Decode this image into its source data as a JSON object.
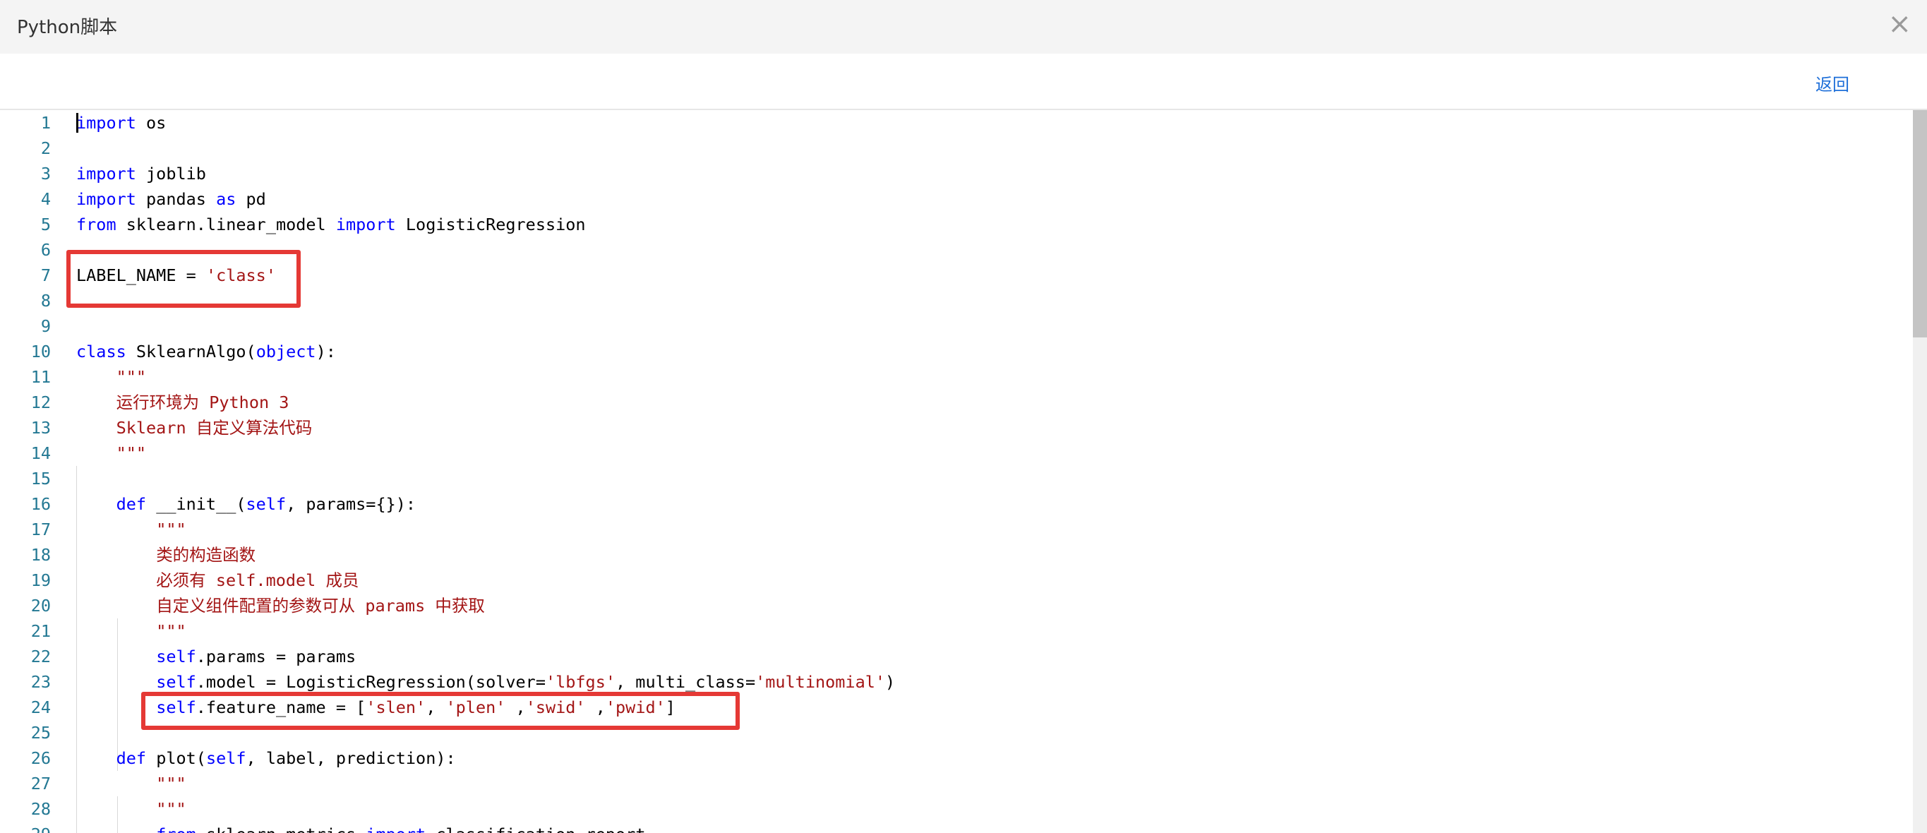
{
  "dialog": {
    "title": "Python脚本",
    "close_icon": "×",
    "back_label": "返回"
  },
  "editor": {
    "language": "python",
    "lines": [
      {
        "num": "1",
        "tokens": [
          {
            "t": "import",
            "c": "kw"
          },
          {
            "t": " os",
            "c": "text"
          }
        ]
      },
      {
        "num": "2",
        "tokens": []
      },
      {
        "num": "3",
        "tokens": [
          {
            "t": "import",
            "c": "kw"
          },
          {
            "t": " joblib",
            "c": "text"
          }
        ]
      },
      {
        "num": "4",
        "tokens": [
          {
            "t": "import",
            "c": "kw"
          },
          {
            "t": " pandas ",
            "c": "text"
          },
          {
            "t": "as",
            "c": "kw"
          },
          {
            "t": " pd",
            "c": "text"
          }
        ]
      },
      {
        "num": "5",
        "tokens": [
          {
            "t": "from",
            "c": "kw"
          },
          {
            "t": " sklearn.linear_model ",
            "c": "text"
          },
          {
            "t": "import",
            "c": "kw"
          },
          {
            "t": " LogisticRegression",
            "c": "text"
          }
        ]
      },
      {
        "num": "6",
        "tokens": []
      },
      {
        "num": "7",
        "tokens": [
          {
            "t": "LABEL_NAME = ",
            "c": "text"
          },
          {
            "t": "'class'",
            "c": "str"
          }
        ]
      },
      {
        "num": "8",
        "tokens": []
      },
      {
        "num": "9",
        "tokens": []
      },
      {
        "num": "10",
        "tokens": [
          {
            "t": "class",
            "c": "kw"
          },
          {
            "t": " SklearnAlgo(",
            "c": "text"
          },
          {
            "t": "object",
            "c": "kw"
          },
          {
            "t": "):",
            "c": "text"
          }
        ]
      },
      {
        "num": "11",
        "tokens": [
          {
            "t": "    ",
            "c": "text"
          },
          {
            "t": "\"\"\"",
            "c": "str"
          }
        ]
      },
      {
        "num": "12",
        "tokens": [
          {
            "t": "    ",
            "c": "text"
          },
          {
            "t": "运行环境为 Python 3",
            "c": "str"
          }
        ]
      },
      {
        "num": "13",
        "tokens": [
          {
            "t": "    ",
            "c": "text"
          },
          {
            "t": "Sklearn 自定义算法代码",
            "c": "str"
          }
        ]
      },
      {
        "num": "14",
        "tokens": [
          {
            "t": "    ",
            "c": "text"
          },
          {
            "t": "\"\"\"",
            "c": "str"
          }
        ]
      },
      {
        "num": "15",
        "tokens": []
      },
      {
        "num": "16",
        "tokens": [
          {
            "t": "    ",
            "c": "text"
          },
          {
            "t": "def",
            "c": "kw"
          },
          {
            "t": " __init__(",
            "c": "text"
          },
          {
            "t": "self",
            "c": "kw"
          },
          {
            "t": ", params={}):",
            "c": "text"
          }
        ]
      },
      {
        "num": "17",
        "tokens": [
          {
            "t": "        ",
            "c": "text"
          },
          {
            "t": "\"\"\"",
            "c": "str"
          }
        ]
      },
      {
        "num": "18",
        "tokens": [
          {
            "t": "        ",
            "c": "text"
          },
          {
            "t": "类的构造函数",
            "c": "str"
          }
        ]
      },
      {
        "num": "19",
        "tokens": [
          {
            "t": "        ",
            "c": "text"
          },
          {
            "t": "必须有 self.model 成员",
            "c": "str"
          }
        ]
      },
      {
        "num": "20",
        "tokens": [
          {
            "t": "        ",
            "c": "text"
          },
          {
            "t": "自定义组件配置的参数可从 params 中获取",
            "c": "str"
          }
        ]
      },
      {
        "num": "21",
        "tokens": [
          {
            "t": "        ",
            "c": "text"
          },
          {
            "t": "\"\"\"",
            "c": "str"
          }
        ]
      },
      {
        "num": "22",
        "tokens": [
          {
            "t": "        ",
            "c": "text"
          },
          {
            "t": "self",
            "c": "kw"
          },
          {
            "t": ".params = params",
            "c": "text"
          }
        ]
      },
      {
        "num": "23",
        "tokens": [
          {
            "t": "        ",
            "c": "text"
          },
          {
            "t": "self",
            "c": "kw"
          },
          {
            "t": ".model = LogisticRegression(solver=",
            "c": "text"
          },
          {
            "t": "'lbfgs'",
            "c": "str"
          },
          {
            "t": ", multi_class=",
            "c": "text"
          },
          {
            "t": "'multinomial'",
            "c": "str"
          },
          {
            "t": ")",
            "c": "text"
          }
        ]
      },
      {
        "num": "24",
        "tokens": [
          {
            "t": "        ",
            "c": "text"
          },
          {
            "t": "self",
            "c": "kw"
          },
          {
            "t": ".feature_name = [",
            "c": "text"
          },
          {
            "t": "'slen'",
            "c": "str"
          },
          {
            "t": ", ",
            "c": "text"
          },
          {
            "t": "'plen'",
            "c": "str"
          },
          {
            "t": " ,",
            "c": "text"
          },
          {
            "t": "'swid'",
            "c": "str"
          },
          {
            "t": " ,",
            "c": "text"
          },
          {
            "t": "'pwid'",
            "c": "str"
          },
          {
            "t": "]",
            "c": "text"
          }
        ]
      },
      {
        "num": "25",
        "tokens": []
      },
      {
        "num": "26",
        "tokens": [
          {
            "t": "    ",
            "c": "text"
          },
          {
            "t": "def",
            "c": "kw"
          },
          {
            "t": " plot(",
            "c": "text"
          },
          {
            "t": "self",
            "c": "kw"
          },
          {
            "t": ", label, prediction):",
            "c": "text"
          }
        ]
      },
      {
        "num": "27",
        "tokens": [
          {
            "t": "        ",
            "c": "text"
          },
          {
            "t": "\"\"\"",
            "c": "str"
          }
        ]
      },
      {
        "num": "28",
        "tokens": [
          {
            "t": "        ",
            "c": "text"
          },
          {
            "t": "\"\"\"",
            "c": "str"
          }
        ]
      },
      {
        "num": "29",
        "tokens": [
          {
            "t": "        ",
            "c": "text"
          },
          {
            "t": "from",
            "c": "kw"
          },
          {
            "t": " sklearn.metrics ",
            "c": "text"
          },
          {
            "t": "import",
            "c": "kw"
          },
          {
            "t": " classification_report",
            "c": "text"
          }
        ]
      }
    ]
  },
  "colors": {
    "keyword": "#0000ff",
    "string": "#a31515",
    "line_number": "#237893",
    "highlight_box": "#e53935",
    "link": "#1e6fd9"
  }
}
